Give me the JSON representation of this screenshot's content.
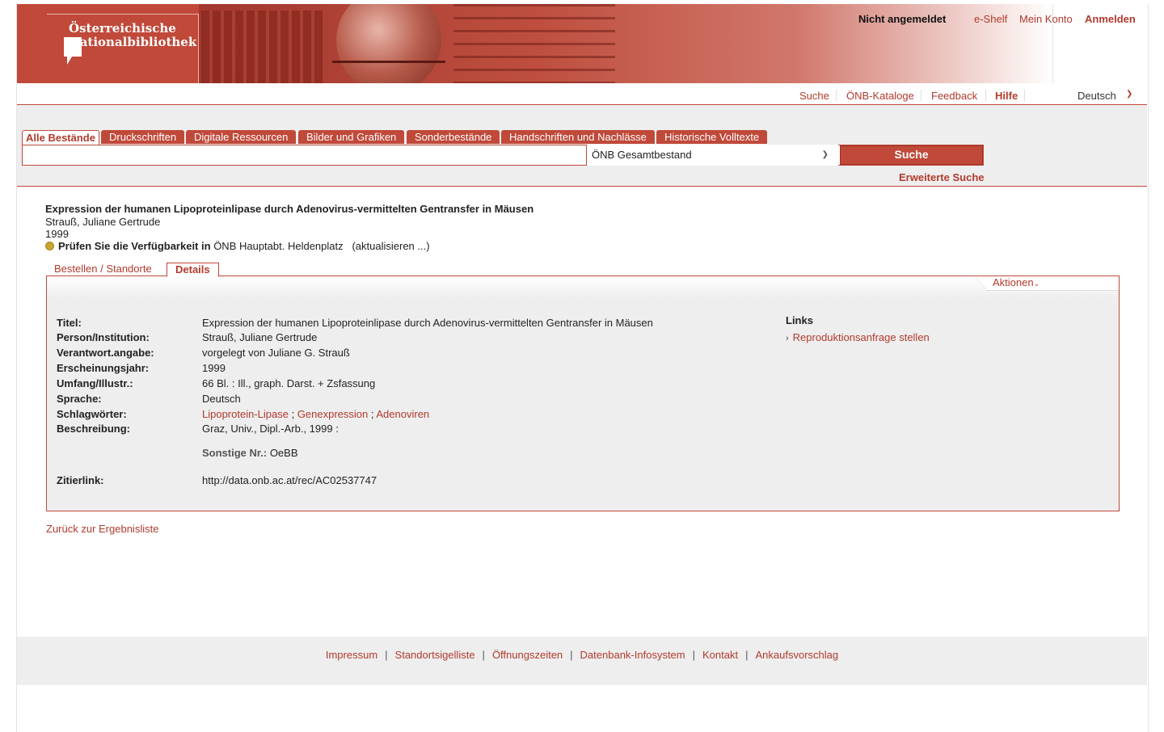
{
  "header": {
    "logo_line1": "Österreichische",
    "logo_line2": "Nationalbibliothek",
    "login_status": "Nicht angemeldet",
    "links": [
      "e-Shelf",
      "Mein Konto",
      "Anmelden"
    ]
  },
  "nav": {
    "items": [
      "Suche",
      "ÖNB-Kataloge",
      "Feedback",
      "Hilfe"
    ],
    "language": "Deutsch"
  },
  "search": {
    "tabs": [
      "Alle Bestände",
      "Druckschriften",
      "Digitale Ressourcen",
      "Bilder und Grafiken",
      "Sonderbestände",
      "Handschriften und Nachlässe",
      "Historische Volltexte"
    ],
    "query": "",
    "scope": "ÖNB Gesamtbestand",
    "button": "Suche",
    "advanced": "Erweiterte Suche"
  },
  "record": {
    "title": "Expression der humanen Lipoproteinlipase durch Adenovirus-vermittelten Gentransfer in Mäusen",
    "author": "Strauß, Juliane Gertrude",
    "year": "1999",
    "availability_label": "Prüfen Sie die Verfügbarkeit in",
    "availability_location": "ÖNB Hauptabt. Heldenplatz",
    "availability_refresh": "(aktualisieren ...)"
  },
  "detail_tabs": [
    "Bestellen / Standorte",
    "Details"
  ],
  "actions_label": "Aktionen",
  "details": {
    "titel_k": "Titel:",
    "titel_v": "Expression der humanen Lipoproteinlipase durch Adenovirus-vermittelten Gentransfer in Mäusen",
    "person_k": "Person/Institution:",
    "person_v": "Strauß, Juliane Gertrude",
    "verantwort_k": "Verantwort.angabe:",
    "verantwort_v": "vorgelegt von Juliane G. Strauß",
    "jahr_k": "Erscheinungsjahr:",
    "jahr_v": "1999",
    "umfang_k": "Umfang/Illustr.:",
    "umfang_v": "66 Bl. : Ill., graph. Darst. + Zsfassung",
    "sprache_k": "Sprache:",
    "sprache_v": "Deutsch",
    "schlag_k": "Schlagwörter:",
    "schlag_v": [
      "Lipoprotein-Lipase",
      "Genexpression",
      "Adenoviren"
    ],
    "beschr_k": "Beschreibung:",
    "beschr_v": "Graz, Univ., Dipl.-Arb., 1999 :",
    "sonstige_k": "Sonstige Nr.:",
    "sonstige_v": "OeBB",
    "zitier_k": "Zitierlink:",
    "zitier_v": "http://data.onb.ac.at/rec/AC02537747"
  },
  "links_panel": {
    "heading": "Links",
    "item": "Reproduktionsanfrage stellen"
  },
  "back_link": "Zurück zur Ergebnisliste",
  "footer": {
    "links": [
      "Impressum",
      "Standortsigelliste",
      "Öffnungszeiten",
      "Datenbank-Infosystem",
      "Kontakt",
      "Ankaufsvorschlag"
    ],
    "separator": "|"
  },
  "colors": {
    "brand": "#c0493a",
    "panel_bg": "#eeeeee",
    "availability_dot": "#c9a52f"
  }
}
